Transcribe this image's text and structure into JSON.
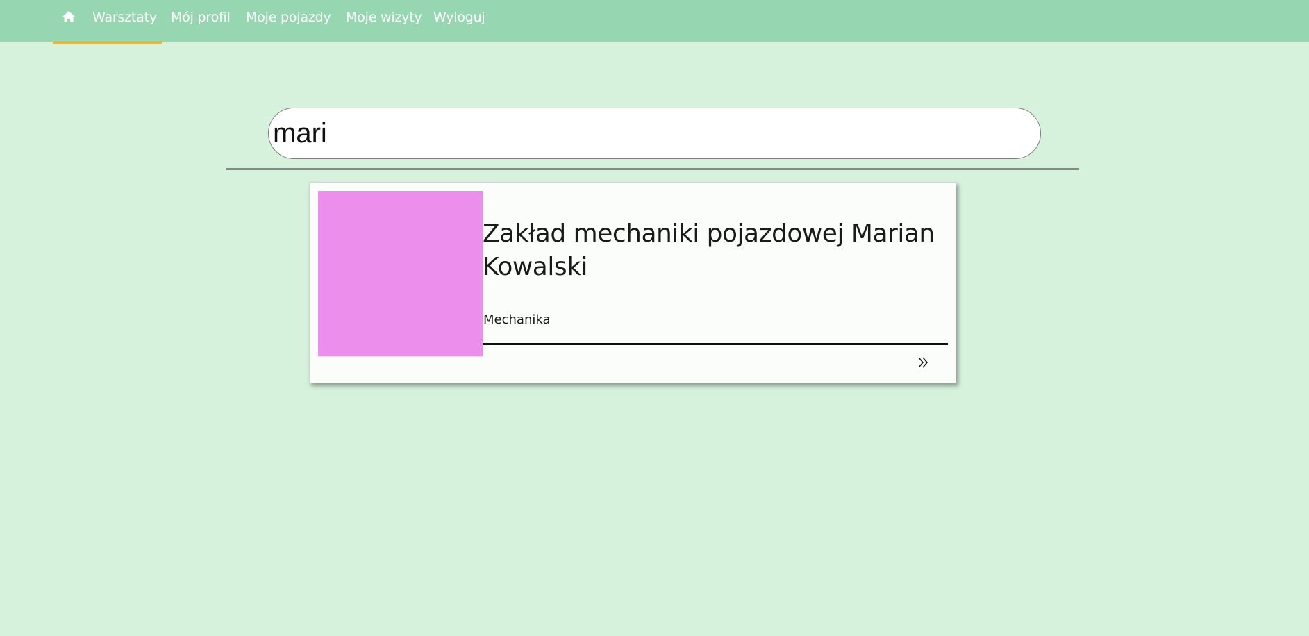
{
  "nav": {
    "home_icon": "home-icon",
    "items": [
      {
        "label": "Warsztaty",
        "active": true
      },
      {
        "label": "Mój profil"
      },
      {
        "label": "Moje pojazdy"
      },
      {
        "label": "Moje wizyty"
      },
      {
        "label": "Wyloguj"
      }
    ],
    "active_color": "#e7b63a",
    "bar_color": "#96d7b1"
  },
  "search": {
    "value": "mari"
  },
  "results": [
    {
      "title": "Zakład mechaniki pojazdowej Marian Kowalski",
      "category": "Mechanika",
      "thumb_color": "#ec8fec",
      "more_icon": "double-chevron-right-icon"
    }
  ],
  "colors": {
    "background": "#d6f2dc",
    "card_background": "#fbfdfa"
  }
}
